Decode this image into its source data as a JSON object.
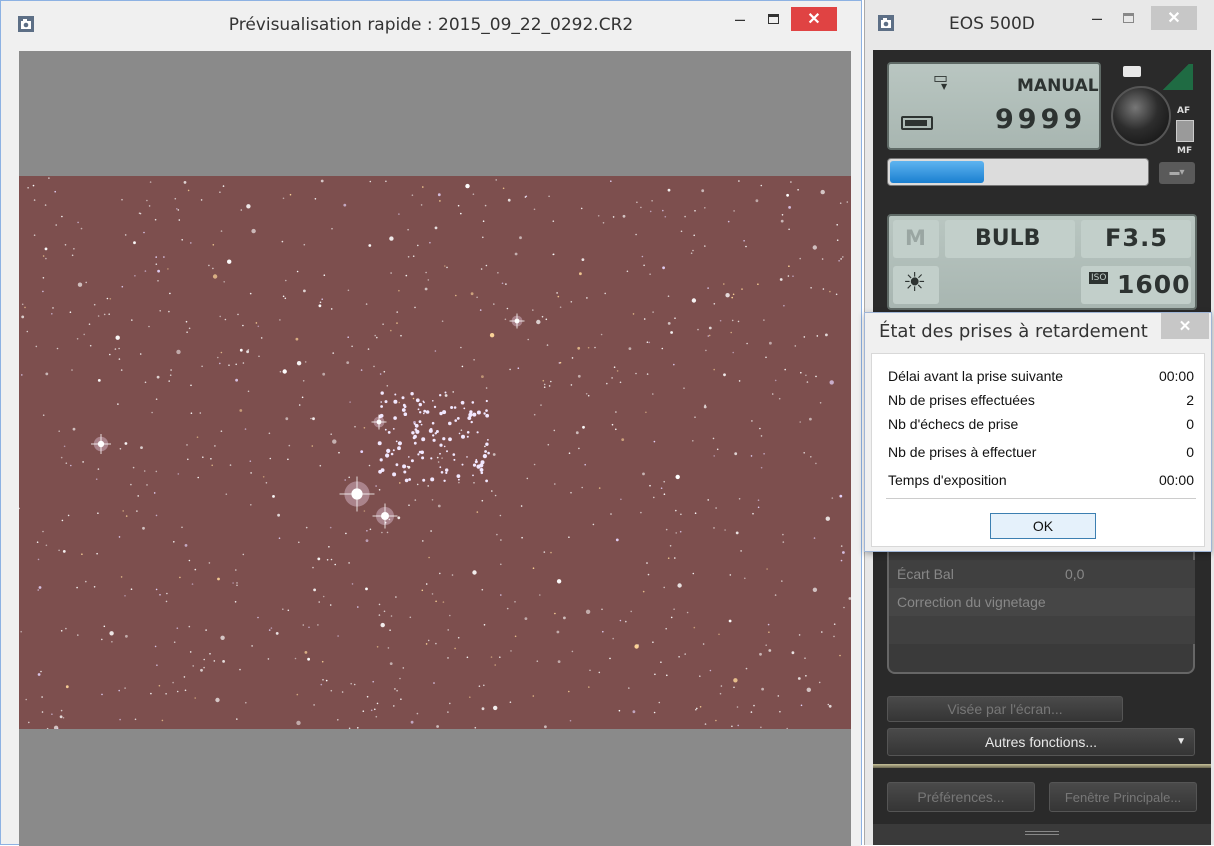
{
  "preview_window": {
    "title": "Prévisualisation rapide : 2015_09_22_0292.CR2",
    "icon": "camera-app-icon",
    "minimize_glyph": "–",
    "close_glyph": "✕"
  },
  "eos_window": {
    "title": "EOS 500D",
    "icon": "camera-app-icon",
    "minimize_glyph": "–",
    "close_glyph": "✕",
    "status_lcd": {
      "drive_glyph": "▭",
      "mode": "MANUAL",
      "shots_remaining": "9999",
      "battery_icon": "battery-icon",
      "af_label": "AF",
      "mf_label": "MF",
      "storage_progress": 0.36
    },
    "settings_lcd": {
      "mode_letter": "M",
      "shutter": "BULB",
      "aperture": "F3.5",
      "iso_label": "ISO",
      "iso_value": "1600",
      "wb_icon": "sun-icon"
    },
    "panel": {
      "rows": [
        {
          "label": "Écart Bal",
          "value": "0,0"
        },
        {
          "label": "Correction du vignetage",
          "value": ""
        }
      ]
    },
    "buttons": {
      "live_view": "Visée par l'écran...",
      "other_functions": "Autres fonctions...",
      "dropdown_glyph": "▼",
      "preferences": "Préférences...",
      "main_window": "Fenêtre Principale..."
    }
  },
  "dialog": {
    "title": "État des prises à retardement",
    "close_glyph": "✕",
    "rows": [
      {
        "label": "Délai avant la prise suivante",
        "value": "00:00"
      },
      {
        "label": "Nb de prises effectuées",
        "value": "2"
      },
      {
        "label": "Nb d'échecs de prise",
        "value": "0"
      },
      {
        "label": "Nb de prises à effectuer",
        "value": "0"
      },
      {
        "label": "Temps d'exposition",
        "value": "00:00"
      }
    ],
    "ok_label": "OK"
  },
  "colors": {
    "sky": "#7d4f4e",
    "close_red": "#e04343",
    "lcd": "#b5c3be",
    "progress_blue": "#2a8ee0"
  }
}
